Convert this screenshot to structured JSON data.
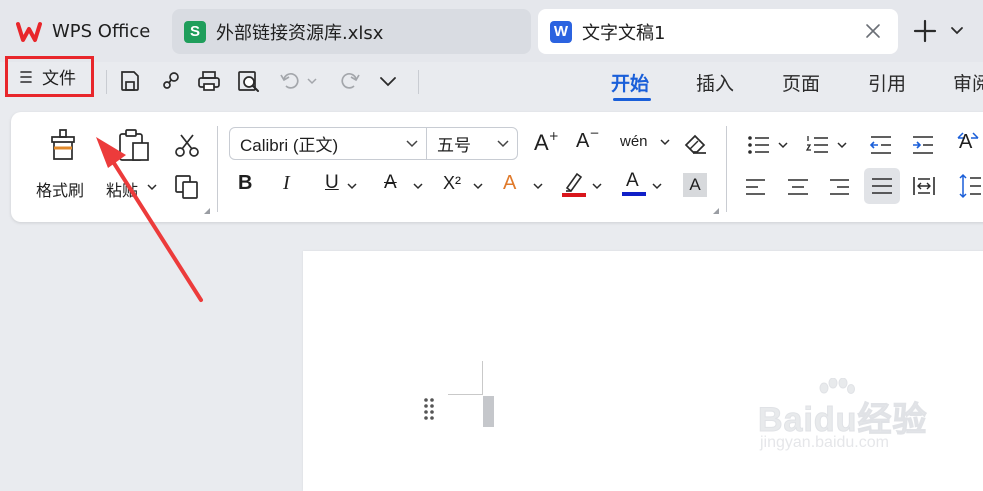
{
  "tabs": [
    {
      "label": "WPS Office"
    },
    {
      "label": "外部链接资源库.xlsx",
      "icon_letter": "S"
    },
    {
      "label": "文字文稿1",
      "icon_letter": "W"
    }
  ],
  "quick_access": {
    "file_label": "文件"
  },
  "menu_tabs": [
    "开始",
    "插入",
    "页面",
    "引用",
    "审阅"
  ],
  "ribbon": {
    "format_painter_label": "格式刷",
    "paste_label": "粘贴",
    "font_name": "Calibri (正文)",
    "font_size": "五号",
    "clear_format_glyph": "A",
    "bold_glyph": "B",
    "italic_glyph": "I",
    "underline_glyph": "U",
    "strike_glyph": "A",
    "superscript_glyph": "X²",
    "grow_glyph": "A",
    "shrink_glyph": "A",
    "pinyin_glyph": "wén",
    "effect_glyph": "A",
    "font_color_glyph": "A",
    "shade_glyph": "A",
    "text_direction_glyph": "A"
  },
  "watermark": {
    "text": "Baidu经验",
    "url": "jingyan.baidu.com"
  },
  "colors": {
    "accent": "#1a5fd9",
    "highlight_box": "#e8262b",
    "arrow": "#ec3b3b",
    "font_color_bar": "#1020c8",
    "highlight_bar": "#d9161c"
  }
}
